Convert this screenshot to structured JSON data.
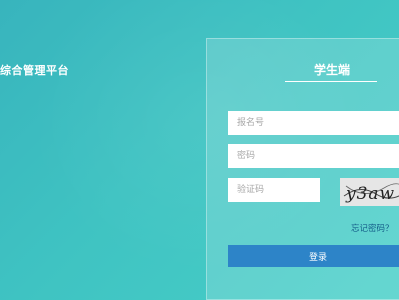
{
  "header": {
    "platform_title": "综合管理平台"
  },
  "login": {
    "tab_title": "学生端",
    "username_placeholder": "报名号",
    "password_placeholder": "密码",
    "captcha_placeholder": "验证码",
    "captcha_text": "y3aw",
    "forgot_password": "忘记密码？",
    "login_button": "登录"
  },
  "colors": {
    "background": "#3fc3c2",
    "button": "#2d84c8",
    "link": "#155f8a"
  }
}
